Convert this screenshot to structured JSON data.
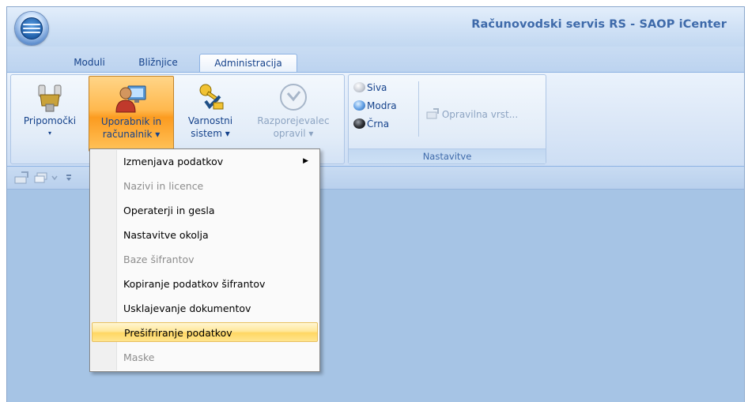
{
  "window": {
    "title": "Računovodski servis RS - SAOP iCenter"
  },
  "tabs": [
    {
      "label": "Moduli"
    },
    {
      "label": "Bližnjice"
    },
    {
      "label": "Administracija"
    }
  ],
  "ribbon": {
    "tools": {
      "buttons": [
        {
          "label1": "Pripomočki",
          "label2": "▾",
          "icon": "plug-icon",
          "state": "normal"
        },
        {
          "label1": "Uporabnik in",
          "label2": "računalnik ▾",
          "icon": "user-computer-icon",
          "state": "pressed"
        },
        {
          "label1": "Varnostni",
          "label2": "sistem ▾",
          "icon": "keys-icon",
          "state": "normal"
        },
        {
          "label1": "Razporejevalec",
          "label2": "opravil ▾",
          "icon": "clock-icon",
          "state": "disabled"
        }
      ]
    },
    "settings": {
      "label": "Nastavitve",
      "themes": [
        {
          "label": "Siva",
          "color": "#c9ced6"
        },
        {
          "label": "Modra",
          "color": "#6aa6e8"
        },
        {
          "label": "Črna",
          "color": "#303338"
        }
      ],
      "task_type_label": "Opravilna vrst..."
    }
  },
  "dropdown_menu": {
    "items": [
      {
        "label": "Izmenjava podatkov",
        "enabled": true,
        "submenu": true,
        "highlighted": false
      },
      {
        "label": "Nazivi in licence",
        "enabled": false,
        "submenu": false,
        "highlighted": false
      },
      {
        "label": "Operaterji in gesla",
        "enabled": true,
        "submenu": false,
        "highlighted": false
      },
      {
        "label": "Nastavitve okolja",
        "enabled": true,
        "submenu": false,
        "highlighted": false
      },
      {
        "label": "Baze šifrantov",
        "enabled": false,
        "submenu": false,
        "highlighted": false
      },
      {
        "label": "Kopiranje podatkov šifrantov",
        "enabled": true,
        "submenu": false,
        "highlighted": false
      },
      {
        "label": "Usklajevanje dokumentov",
        "enabled": true,
        "submenu": false,
        "highlighted": false
      },
      {
        "label": "Prešifriranje podatkov",
        "enabled": true,
        "submenu": false,
        "highlighted": true
      },
      {
        "label": "Maske",
        "enabled": false,
        "submenu": false,
        "highlighted": false
      }
    ],
    "submenu_arrow": "▶"
  },
  "colors": {
    "accent_hover": "#ffb84d",
    "window_bg": "#a6c4e5",
    "title_text": "#3e6aaa"
  }
}
